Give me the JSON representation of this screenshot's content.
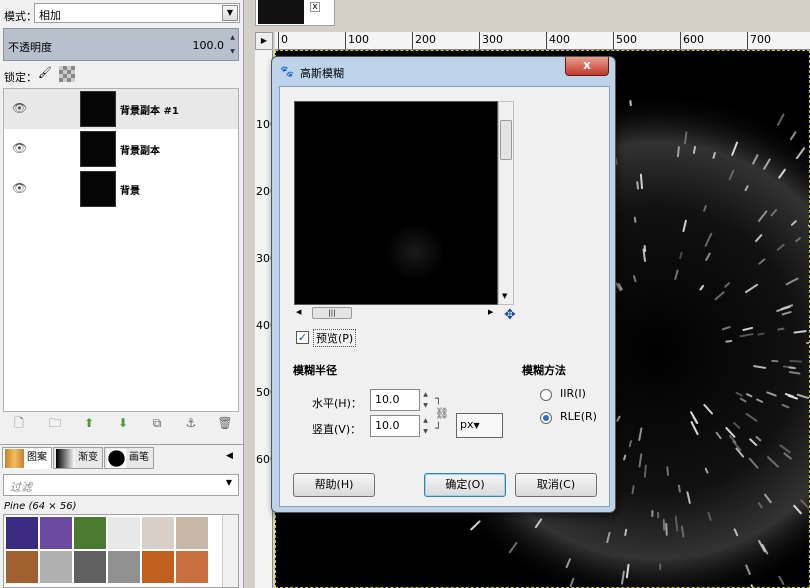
{
  "left_panel": {
    "mode_label": "模式：",
    "mode_value": "相加",
    "opacity_label": "不透明度",
    "opacity_value": "100.0",
    "lock_label": "锁定：",
    "layers": [
      {
        "name": "背景副本 #1",
        "selected": true
      },
      {
        "name": "背景副本",
        "selected": false
      },
      {
        "name": "背景",
        "selected": false
      }
    ],
    "tabs": [
      {
        "label": "图案",
        "icon": "pattern-icon"
      },
      {
        "label": "渐变",
        "icon": "gradient-icon"
      },
      {
        "label": "画笔",
        "icon": "brush-icon"
      }
    ],
    "filter_placeholder": "过滤",
    "pattern_info": "Pine (64 × 56)"
  },
  "ruler": {
    "h_ticks": [
      "0",
      "100",
      "200",
      "300",
      "400",
      "500",
      "600",
      "700"
    ],
    "v_ticks": [
      "100",
      "200",
      "300",
      "400",
      "500",
      "600"
    ]
  },
  "dialog": {
    "title": "高斯模糊",
    "close": "x",
    "preview_label": "预览(P)",
    "preview_checked": true,
    "radius_heading": "模糊半径",
    "horizontal_label": "水平(H)：",
    "horizontal_value": "10.0",
    "vertical_label": "竖直(V)：",
    "vertical_value": "10.0",
    "unit": "px",
    "method_heading": "模糊方法",
    "methods": [
      "IIR(I)",
      "RLE(R)"
    ],
    "selected_method": "RLE(R)",
    "help_button": "帮助(H)",
    "ok_button": "确定(O)",
    "cancel_button": "取消(C)"
  }
}
